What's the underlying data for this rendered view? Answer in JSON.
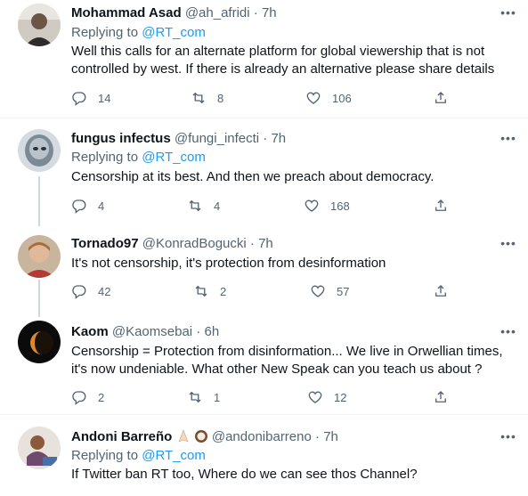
{
  "tweets": [
    {
      "name": "Mohammad Asad",
      "handle": "@ah_afridi",
      "dot": "·",
      "time": "7h",
      "replying_prefix": "Replying to",
      "replying_to": "@RT_com",
      "text": "Well this calls for an alternate platform for global viewership that is not controlled by west. If there is already an alternative please share details",
      "replies": "14",
      "retweets": "8",
      "likes": "106"
    },
    {
      "name": "fungus infectus",
      "handle": "@fungi_infecti",
      "dot": "·",
      "time": "7h",
      "replying_prefix": "Replying to",
      "replying_to": "@RT_com",
      "text": "Censorship at its best. And then we preach about democracy.",
      "replies": "4",
      "retweets": "4",
      "likes": "168"
    },
    {
      "name": "Tornado97",
      "handle": "@KonradBogucki",
      "dot": "·",
      "time": "7h",
      "text": "It's not censorship, it's protection from desinformation",
      "replies": "42",
      "retweets": "2",
      "likes": "57"
    },
    {
      "name": "Kaom",
      "handle": "@Kaomsebai",
      "dot": "·",
      "time": "6h",
      "text": "Censorship = Protection from disinformation... We live in Orwellian times, it's now undeniable. What other  New Speak can you teach us about ?",
      "replies": "2",
      "retweets": "1",
      "likes": "12"
    },
    {
      "name": "Andoni Barreño",
      "handle": "@andonibarreno",
      "dot": "·",
      "time": "7h",
      "replying_prefix": "Replying to",
      "replying_to": "@RT_com",
      "text": "If Twitter ban RT too, Where do we can see thos Channel?"
    }
  ],
  "more_label": "•••",
  "icons": {
    "reply": "reply-icon",
    "retweet": "retweet-icon",
    "like": "heart-icon",
    "share": "share-icon"
  },
  "colors": {
    "link": "#1d9bf0",
    "secondary": "#536471",
    "separator": "#eff3f4"
  }
}
